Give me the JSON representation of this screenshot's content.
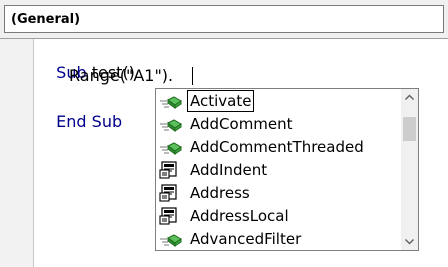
{
  "procedure_combo": {
    "value": "(General)"
  },
  "code": {
    "line1": {
      "keyword": "Sub",
      "rest": " test()"
    },
    "line2": {
      "text": "Range(\"A1\")."
    },
    "line3": {
      "keyword": "End Sub"
    }
  },
  "autocomplete": {
    "selected_index": 0,
    "items": [
      {
        "label": "Activate",
        "icon": "method-icon"
      },
      {
        "label": "AddComment",
        "icon": "method-icon"
      },
      {
        "label": "AddCommentThreaded",
        "icon": "method-icon"
      },
      {
        "label": "AddIndent",
        "icon": "property-icon"
      },
      {
        "label": "Address",
        "icon": "property-icon"
      },
      {
        "label": "AddressLocal",
        "icon": "property-icon"
      },
      {
        "label": "AdvancedFilter",
        "icon": "method-icon"
      }
    ]
  },
  "colors": {
    "keyword": "#00008b",
    "text": "#000000",
    "method_green": "#3ea53e"
  }
}
